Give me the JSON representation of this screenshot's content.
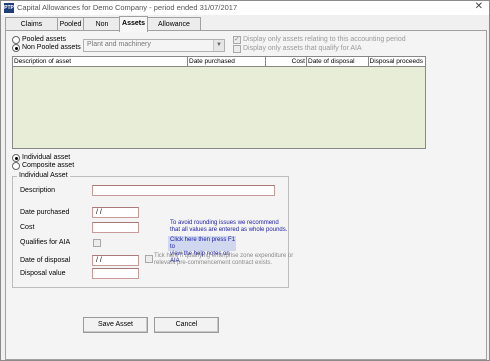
{
  "window": {
    "icon_label": "PTP",
    "title": "Capital Allowances for Demo Company  -  period ended 31/07/2017",
    "close_glyph": "✕"
  },
  "tabs": [
    {
      "label": "Claims Summary"
    },
    {
      "label": "Pooled"
    },
    {
      "label": "Non Pooled"
    },
    {
      "label": "Assets"
    },
    {
      "label": "Allowance Rates"
    }
  ],
  "pool_type": {
    "pooled_label": "Pooled assets",
    "non_pooled_label": "Non Pooled assets",
    "selected": "Non Pooled assets"
  },
  "pool_select": {
    "value": "Plant and machinery"
  },
  "filters": {
    "accounting_period_label": "Display only assets relating to this accounting period",
    "aia_label": "Display only assets that qualify for AIA",
    "accounting_period_checked": true,
    "aia_checked": false
  },
  "table": {
    "columns": [
      "Description of asset",
      "Date purchased",
      "Cost",
      "Date of disposal",
      "Disposal proceeds"
    ],
    "rows": []
  },
  "asset_kind": {
    "individual_label": "Individual asset",
    "composite_label": "Composite asset",
    "selected": "Individual asset"
  },
  "form": {
    "group_title": "Individual Asset",
    "description_label": "Description",
    "description_value": "",
    "date_purchased_label": "Date purchased",
    "date_purchased_value": " / /",
    "cost_label": "Cost",
    "cost_value": "",
    "qualifies_aia_label": "Qualifies for AIA",
    "qualifies_aia_checked": false,
    "date_disposal_label": "Date of disposal",
    "date_disposal_value": " / /",
    "disposal_value_label": "Disposal value",
    "disposal_value_value": "",
    "rounding_note_line1": "To avoid rounding issues we recommend",
    "rounding_note_line2": "that all values are entered as whole pounds.",
    "help_note_line1": "Click here then press F1 to",
    "help_note_line2": "view the help notes on AIA",
    "enterprise_zone_line1": "Tick here if qualifying enterprise zone expenditure or",
    "enterprise_zone_line2": "relevant pre-commencement contract exists."
  },
  "buttons": {
    "save": "Save Asset",
    "cancel": "Cancel"
  }
}
